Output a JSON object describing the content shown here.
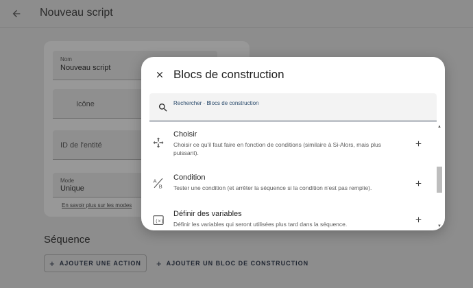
{
  "header": {
    "title": "Nouveau script",
    "back_icon": "arrow-left-icon"
  },
  "form": {
    "name_label": "Nom",
    "name_value": "Nouveau script",
    "icon_placeholder": "Icône",
    "entity_id_placeholder": "ID de l'entité",
    "mode_label": "Mode",
    "mode_value": "Unique",
    "modes_link": "En savoir plus sur les modes"
  },
  "sequence": {
    "title": "Séquence",
    "add_action_label": "AJOUTER UNE ACTION",
    "add_block_label": "AJOUTER UN BLOC DE CONSTRUCTION"
  },
  "dialog": {
    "title": "Blocs de construction",
    "close_icon": "close-icon",
    "search_label": "Rechercher · Blocs de construction",
    "items": [
      {
        "title": "Choisir",
        "description": "Choisir ce qu'il faut faire en fonction de conditions (similaire à Si-Alors, mais plus puissant).",
        "icon": "arrow-decision-icon"
      },
      {
        "title": "Condition",
        "description": "Tester une condition (et arrêter la séquence si la condition n'est pas remplie).",
        "icon": "a-b-icon"
      },
      {
        "title": "Définir des variables",
        "description": "Définir les variables qui seront utilisées plus tard dans la séquence.",
        "icon": "variable-icon"
      }
    ]
  },
  "colors": {
    "accent": "#2b3a4f",
    "scrim": "#8d8d8d",
    "dialog_bg": "#ffffff"
  }
}
